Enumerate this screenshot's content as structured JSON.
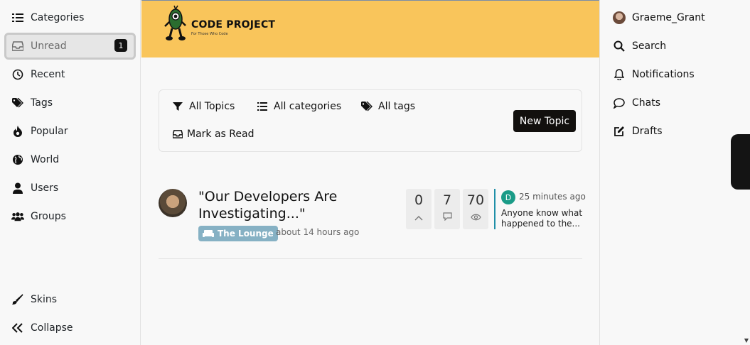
{
  "left_nav": {
    "items": [
      {
        "label": "Categories",
        "icon": "list-icon"
      },
      {
        "label": "Unread",
        "icon": "inbox-icon",
        "badge": "1",
        "active": true
      },
      {
        "label": "Recent",
        "icon": "clock-icon"
      },
      {
        "label": "Tags",
        "icon": "tags-icon"
      },
      {
        "label": "Popular",
        "icon": "fire-icon"
      },
      {
        "label": "World",
        "icon": "globe-icon"
      },
      {
        "label": "Users",
        "icon": "user-icon"
      },
      {
        "label": "Groups",
        "icon": "users-icon"
      },
      {
        "label": "Skins",
        "icon": "paintbrush-icon"
      },
      {
        "label": "Collapse",
        "icon": "double-chevron-left-icon"
      }
    ]
  },
  "header": {
    "logo_text": "CODE PROJECT",
    "logo_tagline": "For Those Who Code",
    "colors": {
      "background": "#f9c55b"
    }
  },
  "topic_bar": {
    "all_topics": "All Topics",
    "all_categories": "All categories",
    "all_tags": "All tags",
    "mark_as_read": "Mark as Read",
    "new_topic": "New Topic"
  },
  "topic": {
    "title": "\"Our Developers Are Investigating...\"",
    "category": "The Lounge",
    "category_color": "#86b1c4",
    "time": "about 14 hours ago",
    "stats": {
      "votes": "0",
      "posts": "7",
      "views": "70"
    },
    "teaser": {
      "avatar_letter": "D",
      "time": "25 minutes ago",
      "text": "Anyone know what happened to the..."
    }
  },
  "right_nav": {
    "username": "Graeme_Grant",
    "search": "Search",
    "notifications": "Notifications",
    "chats": "Chats",
    "drafts": "Drafts"
  }
}
